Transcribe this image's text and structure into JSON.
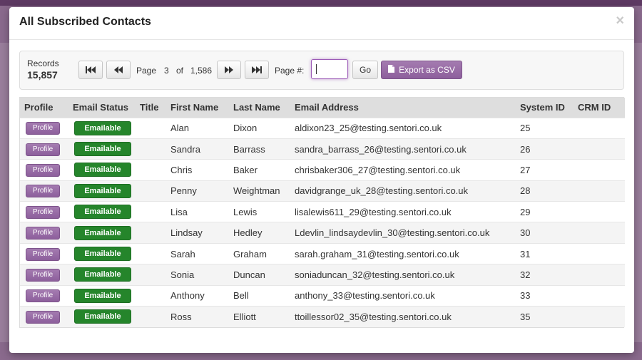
{
  "modal": {
    "title": "All Subscribed Contacts",
    "close_glyph": "×"
  },
  "toolbar": {
    "records_label": "Records",
    "records_count": "15,857",
    "page_label": "Page",
    "current_page": "3",
    "of_label": "of",
    "total_pages": "1,586",
    "page_number_label": "Page #:",
    "page_input_value": "",
    "go_label": "Go",
    "export_label": "Export as CSV",
    "icons": {
      "first": "first-page-icon",
      "prev": "previous-page-icon",
      "next": "next-page-icon",
      "last": "last-page-icon",
      "export": "file-icon"
    }
  },
  "table": {
    "columns": [
      "Profile",
      "Email Status",
      "Title",
      "First Name",
      "Last Name",
      "Email Address",
      "System ID",
      "CRM ID"
    ],
    "profile_button_label": "Profile",
    "rows": [
      {
        "status": "Emailable",
        "title": "",
        "first": "Alan",
        "last": "Dixon",
        "email": "aldixon23_25@testing.sentori.co.uk",
        "system_id": "25",
        "crm_id": ""
      },
      {
        "status": "Emailable",
        "title": "",
        "first": "Sandra",
        "last": "Barrass",
        "email": "sandra_barrass_26@testing.sentori.co.uk",
        "system_id": "26",
        "crm_id": ""
      },
      {
        "status": "Emailable",
        "title": "",
        "first": "Chris",
        "last": "Baker",
        "email": "chrisbaker306_27@testing.sentori.co.uk",
        "system_id": "27",
        "crm_id": ""
      },
      {
        "status": "Emailable",
        "title": "",
        "first": "Penny",
        "last": "Weightman",
        "email": "davidgrange_uk_28@testing.sentori.co.uk",
        "system_id": "28",
        "crm_id": ""
      },
      {
        "status": "Emailable",
        "title": "",
        "first": "Lisa",
        "last": "Lewis",
        "email": "lisalewis611_29@testing.sentori.co.uk",
        "system_id": "29",
        "crm_id": ""
      },
      {
        "status": "Emailable",
        "title": "",
        "first": "Lindsay",
        "last": "Hedley",
        "email": "Ldevlin_lindsaydevlin_30@testing.sentori.co.uk",
        "system_id": "30",
        "crm_id": ""
      },
      {
        "status": "Emailable",
        "title": "",
        "first": "Sarah",
        "last": "Graham",
        "email": "sarah.graham_31@testing.sentori.co.uk",
        "system_id": "31",
        "crm_id": ""
      },
      {
        "status": "Emailable",
        "title": "",
        "first": "Sonia",
        "last": "Duncan",
        "email": "soniaduncan_32@testing.sentori.co.uk",
        "system_id": "32",
        "crm_id": ""
      },
      {
        "status": "Emailable",
        "title": "",
        "first": "Anthony",
        "last": "Bell",
        "email": "anthony_33@testing.sentori.co.uk",
        "system_id": "33",
        "crm_id": ""
      },
      {
        "status": "Emailable",
        "title": "",
        "first": "Ross",
        "last": "Elliott",
        "email": "ttoillessor02_35@testing.sentori.co.uk",
        "system_id": "35",
        "crm_id": ""
      }
    ]
  },
  "colors": {
    "accent_purple": "#9b6ba8",
    "emailable_green": "#25852b",
    "backdrop": "#7a4f7e"
  }
}
